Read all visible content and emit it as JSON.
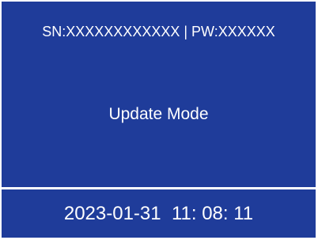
{
  "screen": {
    "credentials": "SN:XXXXXXXXXXXX | PW:XXXXXX",
    "mode": "Update Mode",
    "datetime": "2023-01-31  11: 08: 11"
  },
  "colors": {
    "background": "#1f3c9a",
    "text": "#ffffff",
    "divider": "#ffffff"
  }
}
